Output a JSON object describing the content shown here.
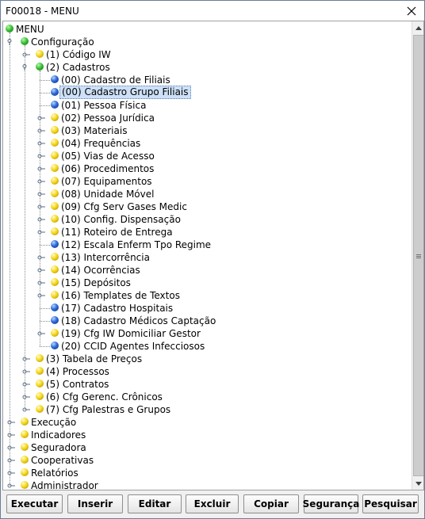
{
  "window": {
    "title": "F00018 - MENU"
  },
  "tree": {
    "root": {
      "label": "MENU",
      "color": "green"
    },
    "nodes": [
      {
        "id": "configuracao",
        "label": "Configuração",
        "color": "green",
        "depth": 1,
        "expanded": true
      },
      {
        "id": "codigo-iw",
        "label": "(1) Código IW",
        "color": "yellow",
        "depth": 2,
        "expanded": false
      },
      {
        "id": "cadastros",
        "label": "(2) Cadastros",
        "color": "green",
        "depth": 2,
        "expanded": true
      },
      {
        "id": "cadastro-filiais",
        "label": "(00) Cadastro de Filiais",
        "color": "blue",
        "depth": 3,
        "leaf": true
      },
      {
        "id": "cadastro-grupo-filiais",
        "label": "(00) Cadastro Grupo Filiais",
        "color": "blue",
        "depth": 3,
        "leaf": true,
        "selected": true
      },
      {
        "id": "pessoa-fisica",
        "label": "(01) Pessoa Física",
        "color": "blue",
        "depth": 3,
        "leaf": true
      },
      {
        "id": "pessoa-juridica",
        "label": "(02) Pessoa Jurídica",
        "color": "yellow",
        "depth": 3
      },
      {
        "id": "materiais",
        "label": "(03) Materiais",
        "color": "yellow",
        "depth": 3
      },
      {
        "id": "frequencias",
        "label": "(04) Frequências",
        "color": "yellow",
        "depth": 3
      },
      {
        "id": "vias-de-acesso",
        "label": "(05) Vias de Acesso",
        "color": "yellow",
        "depth": 3
      },
      {
        "id": "procedimentos",
        "label": "(06) Procedimentos",
        "color": "yellow",
        "depth": 3
      },
      {
        "id": "equipamentos",
        "label": "(07) Equipamentos",
        "color": "yellow",
        "depth": 3
      },
      {
        "id": "unidade-movel",
        "label": "(08) Unidade Móvel",
        "color": "yellow",
        "depth": 3
      },
      {
        "id": "cfg-serv-gases-medic",
        "label": "(09) Cfg Serv Gases Medic",
        "color": "yellow",
        "depth": 3
      },
      {
        "id": "config-dispensacao",
        "label": "(10) Config. Dispensação",
        "color": "yellow",
        "depth": 3
      },
      {
        "id": "roteiro-de-entrega",
        "label": "(11) Roteiro de Entrega",
        "color": "yellow",
        "depth": 3
      },
      {
        "id": "escala-enferm",
        "label": "(12) Escala Enferm Tpo Regime",
        "color": "blue",
        "depth": 3,
        "leaf": true
      },
      {
        "id": "intercorrencia",
        "label": "(13) Intercorrência",
        "color": "yellow",
        "depth": 3
      },
      {
        "id": "ocorrencias",
        "label": "(14) Ocorrências",
        "color": "yellow",
        "depth": 3
      },
      {
        "id": "depositos",
        "label": "(15) Depósitos",
        "color": "yellow",
        "depth": 3
      },
      {
        "id": "templates-de-textos",
        "label": "(16) Templates de Textos",
        "color": "yellow",
        "depth": 3
      },
      {
        "id": "cadastro-hospitais",
        "label": "(17) Cadastro Hospitais",
        "color": "blue",
        "depth": 3,
        "leaf": true
      },
      {
        "id": "cadastro-medicos-captacao",
        "label": "(18) Cadastro Médicos Captação",
        "color": "blue",
        "depth": 3,
        "leaf": true
      },
      {
        "id": "cfg-iw-domiciliar-gestor",
        "label": "(19) Cfg IW Domiciliar Gestor",
        "color": "yellow",
        "depth": 3
      },
      {
        "id": "ccid-agentes-infecciosos",
        "label": "(20) CCID Agentes Infecciosos",
        "color": "blue",
        "depth": 3,
        "leaf": true
      },
      {
        "id": "tabela-de-precos",
        "label": "(3) Tabela de Preços",
        "color": "yellow",
        "depth": 2
      },
      {
        "id": "processos",
        "label": "(4) Processos",
        "color": "yellow",
        "depth": 2
      },
      {
        "id": "contratos",
        "label": "(5) Contratos",
        "color": "yellow",
        "depth": 2
      },
      {
        "id": "cfg-gerenc-cronicos",
        "label": "(6) Cfg Gerenc. Crônicos",
        "color": "yellow",
        "depth": 2
      },
      {
        "id": "cfg-palestras-e-grupos",
        "label": "(7) Cfg Palestras e Grupos",
        "color": "yellow",
        "depth": 2
      },
      {
        "id": "execucao",
        "label": "Execução",
        "color": "yellow",
        "depth": 1
      },
      {
        "id": "indicadores",
        "label": "Indicadores",
        "color": "yellow",
        "depth": 1
      },
      {
        "id": "seguradora",
        "label": "Seguradora",
        "color": "yellow",
        "depth": 1
      },
      {
        "id": "cooperativas",
        "label": "Cooperativas",
        "color": "yellow",
        "depth": 1
      },
      {
        "id": "relatorios",
        "label": "Relatórios",
        "color": "yellow",
        "depth": 1
      },
      {
        "id": "administrador",
        "label": "Administrador",
        "color": "yellow",
        "depth": 1
      }
    ]
  },
  "scrollbar": {
    "position": 0
  },
  "buttons": [
    {
      "id": "executar",
      "label": "Executar"
    },
    {
      "id": "inserir",
      "label": "Inserir"
    },
    {
      "id": "editar",
      "label": "Editar"
    },
    {
      "id": "excluir",
      "label": "Excluir"
    },
    {
      "id": "copiar",
      "label": "Copiar"
    },
    {
      "id": "seguranca",
      "label": "Segurança"
    },
    {
      "id": "pesquisar",
      "label": "Pesquisar"
    }
  ]
}
